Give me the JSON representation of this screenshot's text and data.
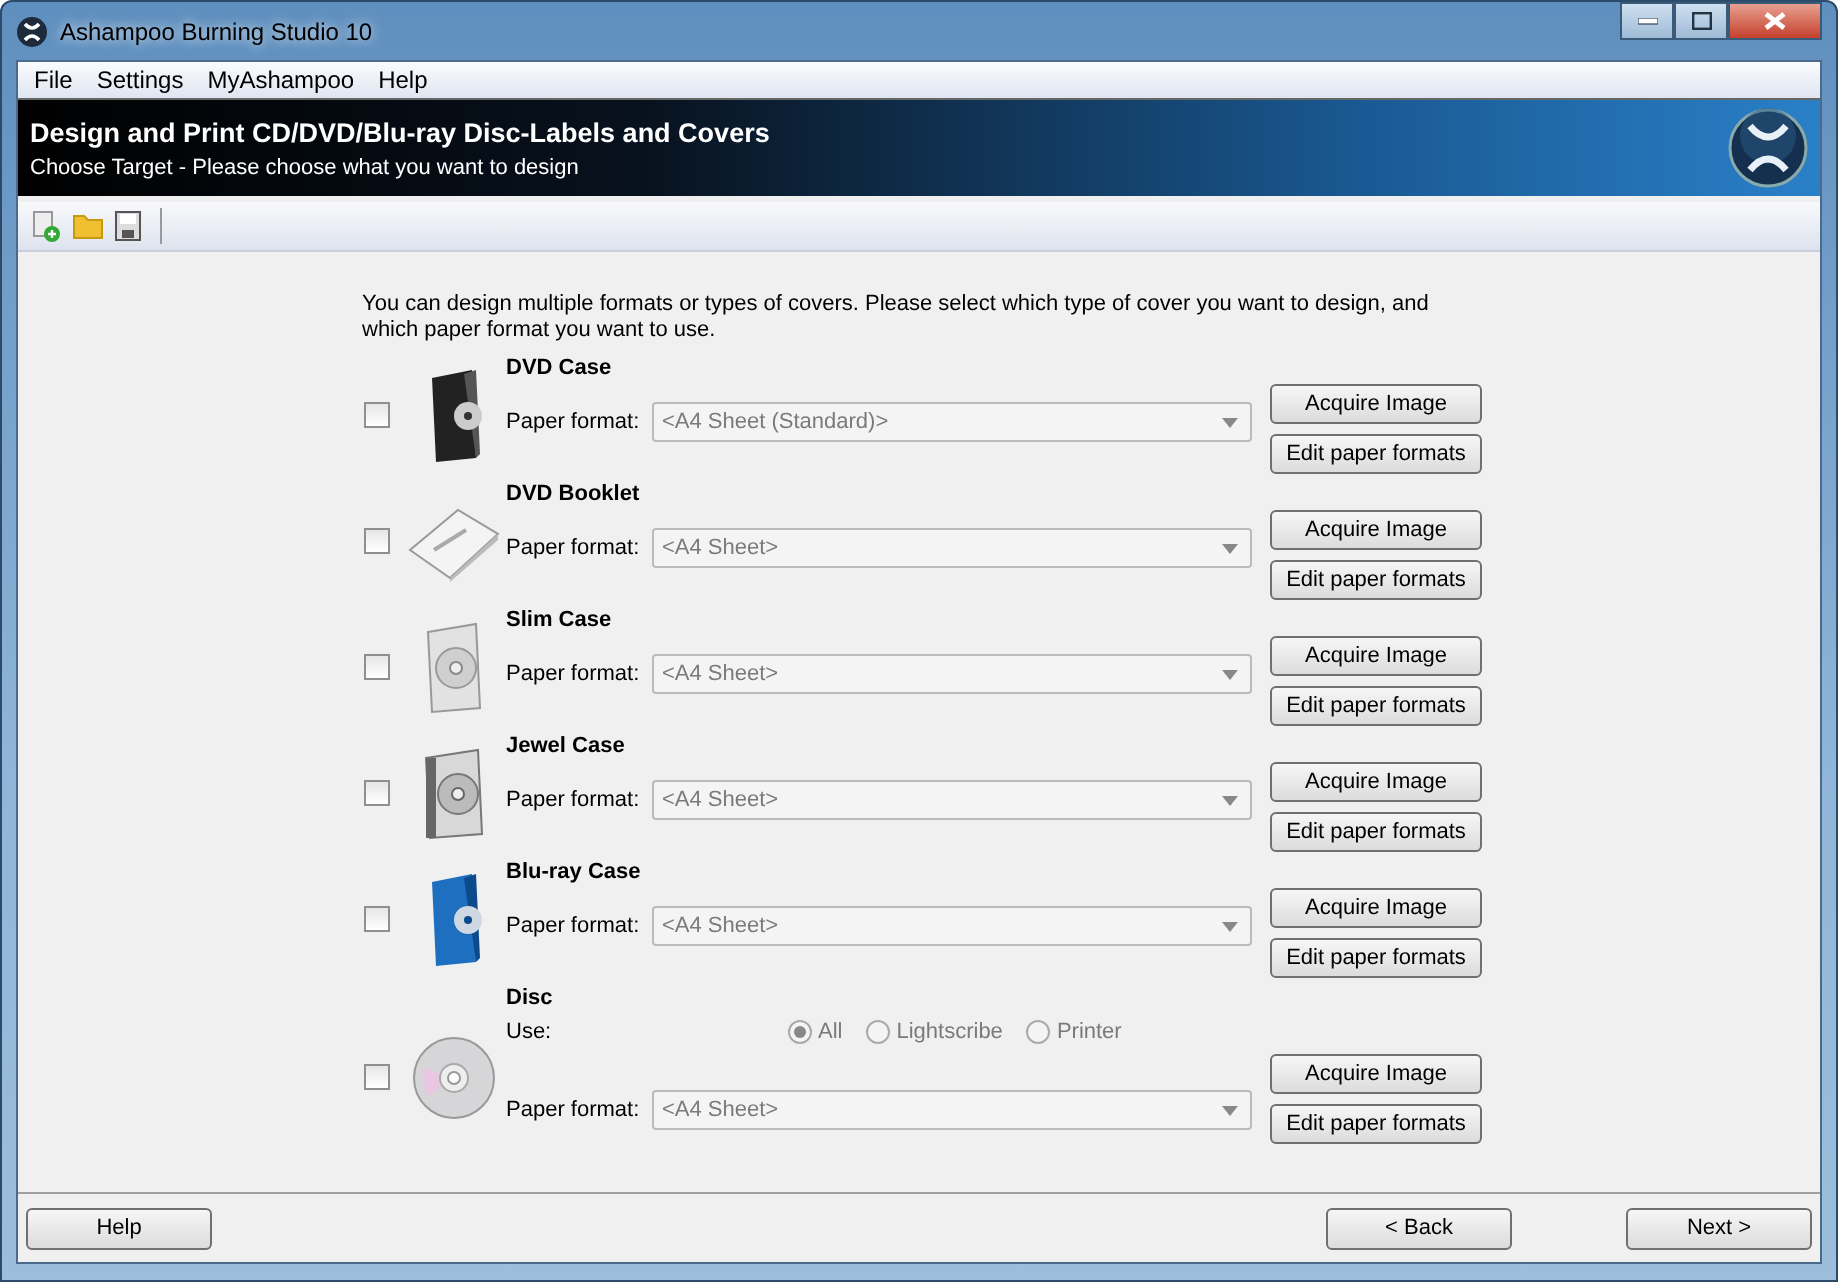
{
  "window": {
    "title": "Ashampoo Burning Studio 10"
  },
  "menu": [
    {
      "label": "File"
    },
    {
      "label": "Settings"
    },
    {
      "label": "MyAshampoo"
    },
    {
      "label": "Help"
    }
  ],
  "header": {
    "title": "Design and Print CD/DVD/Blu-ray Disc-Labels and Covers",
    "subtitle": "Choose Target - Please choose what you want to design"
  },
  "intro": "You can design multiple formats or types of covers. Please select which type of cover you want to design, and which paper format you want to use.",
  "covers": [
    {
      "kind": "dvd-case",
      "name": "DVD Case",
      "checked": false,
      "paper_label": "Paper format:",
      "paper_format": {
        "value": "<A4 Sheet (Standard)>",
        "disabled": true
      },
      "buttons": [
        "Acquire Image",
        "Edit paper formats"
      ]
    },
    {
      "kind": "booklet",
      "name": "DVD Booklet",
      "checked": false,
      "paper_label": "Paper format:",
      "paper_format": {
        "value": "<A4 Sheet>",
        "disabled": true
      },
      "buttons": [
        "Acquire Image",
        "Edit paper formats"
      ]
    },
    {
      "kind": "slim-case",
      "name": "Slim Case",
      "checked": false,
      "paper_label": "Paper format:",
      "paper_format": {
        "value": "<A4 Sheet>",
        "disabled": true
      },
      "buttons": [
        "Acquire Image",
        "Edit paper formats"
      ]
    },
    {
      "kind": "jewel-case",
      "name": "Jewel Case",
      "checked": false,
      "paper_label": "Paper format:",
      "paper_format": {
        "value": "<A4 Sheet>",
        "disabled": true
      },
      "buttons": [
        "Acquire Image",
        "Edit paper formats"
      ]
    },
    {
      "kind": "bluray-case",
      "name": "Blu-ray Case",
      "checked": false,
      "paper_label": "Paper format:",
      "paper_format": {
        "value": "<A4 Sheet>",
        "disabled": true
      },
      "buttons": [
        "Acquire Image",
        "Edit paper formats"
      ]
    },
    {
      "kind": "disc",
      "name": "Disc",
      "checked": false,
      "use_label": "Use:",
      "use_options": [
        {
          "label": "All",
          "selected": true,
          "disabled": true
        },
        {
          "label": "Lightscribe",
          "selected": false,
          "disabled": true
        },
        {
          "label": "Printer",
          "selected": false,
          "disabled": true
        }
      ],
      "paper_label": "Paper format:",
      "paper_format": {
        "value": "<A4 Sheet>",
        "disabled": true
      },
      "buttons": [
        "Acquire Image",
        "Edit paper formats"
      ]
    }
  ],
  "footer": {
    "help": "Help",
    "back": "< Back",
    "next": "Next >"
  }
}
